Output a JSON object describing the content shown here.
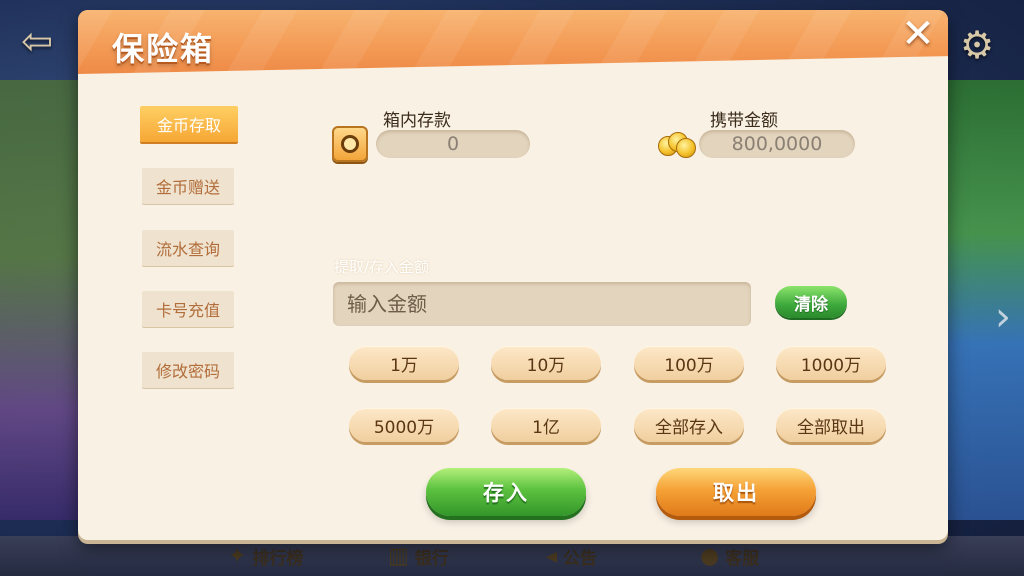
{
  "dialog": {
    "title": "保险箱",
    "close_label": "✕"
  },
  "side_menu": {
    "items": [
      {
        "label": "金币存取",
        "active": true
      },
      {
        "label": "金币赠送",
        "active": false
      },
      {
        "label": "流水查询",
        "active": false
      },
      {
        "label": "卡号充值",
        "active": false
      },
      {
        "label": "修改密码",
        "active": false
      }
    ]
  },
  "balances": {
    "safe_label": "箱内存款",
    "safe_value": "0",
    "carry_label": "携带金额",
    "carry_value": "800,0000"
  },
  "amount": {
    "label": "提取/存入金额",
    "placeholder": "输入金额",
    "clear_label": "清除"
  },
  "quick_amounts": [
    "1万",
    "10万",
    "100万",
    "1000万",
    "5000万",
    "1亿",
    "全部存入",
    "全部取出"
  ],
  "actions": {
    "deposit_label": "存入",
    "withdraw_label": "取出"
  },
  "bottom_nav": {
    "rank": "排行榜",
    "bank": "银行",
    "notice": "公告",
    "service": "客服"
  },
  "icons": {
    "exit": "exit-door-icon",
    "settings": "gear-icon",
    "safe": "safe-icon",
    "coins": "coins-icon"
  }
}
